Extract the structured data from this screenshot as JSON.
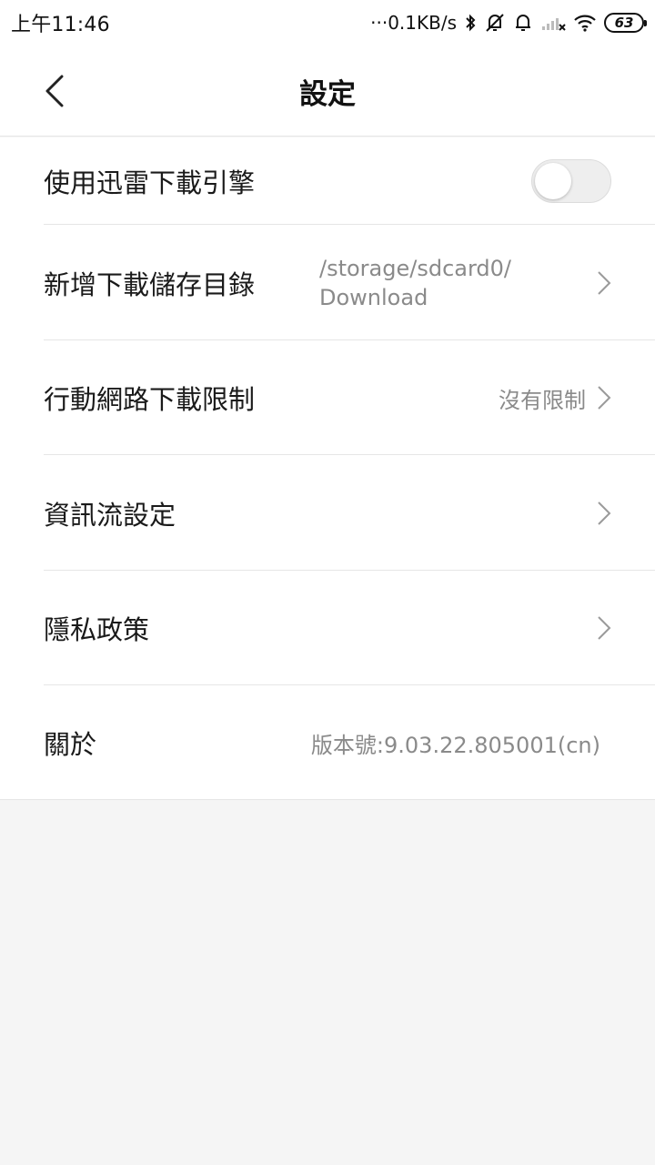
{
  "status_bar": {
    "time": "上午11:46",
    "network_speed": "···0.1KB/s",
    "battery": "63"
  },
  "header": {
    "title": "設定"
  },
  "settings": {
    "thunder_engine": {
      "label": "使用迅雷下載引擎",
      "enabled": false
    },
    "download_dir": {
      "label": "新增下載儲存目錄",
      "path_line1": "/storage/sdcard0/",
      "path_line2": "Download"
    },
    "mobile_limit": {
      "label": "行動網路下載限制",
      "value": "沒有限制"
    },
    "feed": {
      "label": "資訊流設定"
    },
    "privacy": {
      "label": "隱私政策"
    },
    "about": {
      "label": "關於",
      "value": "版本號:9.03.22.805001(cn)"
    }
  },
  "colors": {
    "background": "#f5f5f5",
    "surface": "#ffffff",
    "text_primary": "#1a1a1a",
    "text_secondary": "#8a8a8a",
    "divider": "#e6e6e6"
  }
}
